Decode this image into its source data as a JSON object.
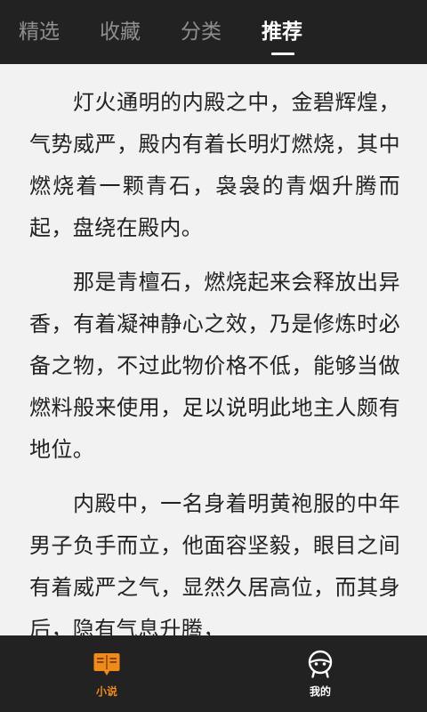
{
  "colors": {
    "bar_background": "#222222",
    "page_background": "#f2f2f2",
    "text": "#222222",
    "tab_inactive": "#8f8f8f",
    "tab_active": "#ffffff",
    "accent": "#f08a1c"
  },
  "top_tabs": [
    {
      "label": "精选",
      "active": false
    },
    {
      "label": "收藏",
      "active": false
    },
    {
      "label": "分类",
      "active": false
    },
    {
      "label": "推荐",
      "active": true
    }
  ],
  "article": {
    "paragraphs": [
      "灯火通明的内殿之中，金碧辉煌，气势威严，殿内有着长明灯燃烧，其中燃烧着一颗青石，袅袅的青烟升腾而起，盘绕在殿内。",
      "那是青檀石，燃烧起来会释放出异香，有着凝神静心之效，乃是修炼时必备之物，不过此物价格不低，能够当做燃料般来使用，足以说明此地主人颇有地位。",
      "内殿中，一名身着明黄袍服的中年男子负手而立，他面容坚毅，眼目之间有着威严之气，显然久居高位，而其身后，隐有气息升腾，"
    ]
  },
  "bottom_nav": [
    {
      "label": "小说",
      "icon": "book-icon",
      "active": true
    },
    {
      "label": "我的",
      "icon": "profile-icon",
      "active": false
    }
  ]
}
